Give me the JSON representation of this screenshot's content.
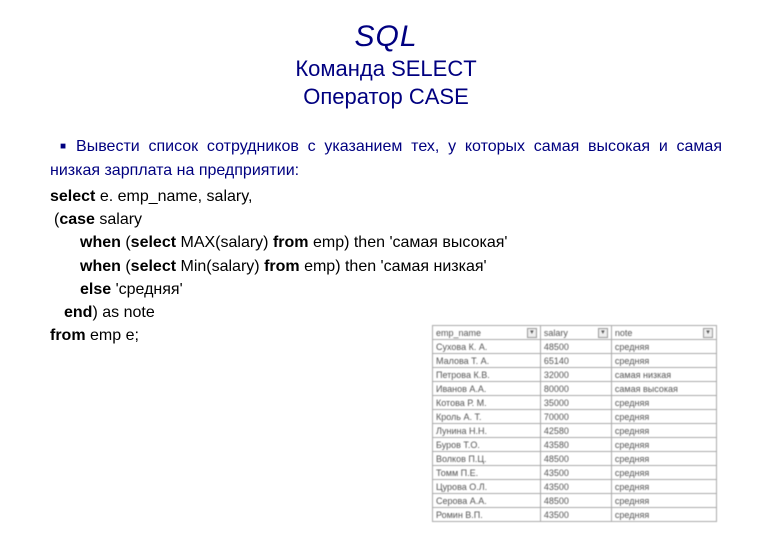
{
  "title": {
    "main": "SQL",
    "sub1": "Команда SELECT",
    "sub2": "Оператор CASE"
  },
  "task": "Вывести список сотрудников с указанием тех, у которых самая высокая и самая низкая зарплата на предприятии:",
  "code": {
    "l1_a": "select",
    "l1_b": " e. emp_name, salary,",
    "l2_a": " (",
    "l2_b": "case",
    "l2_c": " salary",
    "l3_a": "when",
    "l3_b": " (",
    "l3_c": "select",
    "l3_d": " MAX(salary) ",
    "l3_e": "from",
    "l3_f": " emp) then 'самая высокая'",
    "l4_a": "when",
    "l4_b": " (",
    "l4_c": "select",
    "l4_d": " Min(salary) ",
    "l4_e": "from",
    "l4_f": " emp) then 'самая низкая'",
    "l5_a": "else",
    "l5_b": " 'средняя'",
    "l6_a": "end",
    "l6_b": ")  as note",
    "l7_a": "from",
    "l7_b": " emp e;"
  },
  "chart_data": {
    "type": "table",
    "headers": [
      "emp_name",
      "salary",
      "note"
    ],
    "rows": [
      [
        "Сухова К. А.",
        "48500",
        "средняя"
      ],
      [
        "Малова Т. А.",
        "65140",
        "средняя"
      ],
      [
        "Петрова К.В.",
        "32000",
        "самая низкая"
      ],
      [
        "Иванов А.А.",
        "80000",
        "самая высокая"
      ],
      [
        "Котова Р. М.",
        "35000",
        "средняя"
      ],
      [
        "Кроль А. Т.",
        "70000",
        "средняя"
      ],
      [
        "Лунина Н.Н.",
        "42580",
        "средняя"
      ],
      [
        "Буров Т.О.",
        "43580",
        "средняя"
      ],
      [
        "Волков П.Ц.",
        "48500",
        "средняя"
      ],
      [
        "Томм П.Е.",
        "43500",
        "средняя"
      ],
      [
        "Цурова О.Л.",
        "43500",
        "средняя"
      ],
      [
        "Серова А.А.",
        "48500",
        "средняя"
      ],
      [
        "Ромин В.П.",
        "43500",
        "средняя"
      ]
    ]
  }
}
